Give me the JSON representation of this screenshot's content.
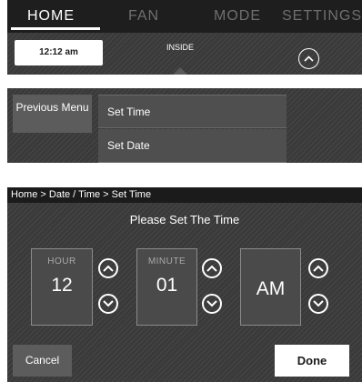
{
  "tabs": [
    {
      "label": "HOME",
      "active": true
    },
    {
      "label": "FAN",
      "active": false
    },
    {
      "label": "MODE",
      "active": false
    },
    {
      "label": "SETTINGS",
      "active": false
    }
  ],
  "home_status": {
    "time": "12:12 am",
    "inside_label": "INSIDE",
    "expand_icon": "chevron-up-icon"
  },
  "menu": {
    "previous_label": "Previous Menu",
    "items": [
      "Set Time",
      "Set Date"
    ]
  },
  "set_time": {
    "breadcrumb": "Home > Date / Time > Set Time",
    "prompt": "Please Set The Time",
    "hour": {
      "label": "HOUR",
      "value": "12"
    },
    "minute": {
      "label": "MINUTE",
      "value": "01"
    },
    "ampm": {
      "value": "AM"
    },
    "up_icon": "chevron-up-icon",
    "down_icon": "chevron-down-icon",
    "cancel_label": "Cancel",
    "done_label": "Done"
  },
  "colors": {
    "panel_background": "#3a3a3a",
    "tab_bar": "#1e1e1e",
    "active_text": "#ffffff",
    "inactive_text": "#6f6f6f"
  }
}
